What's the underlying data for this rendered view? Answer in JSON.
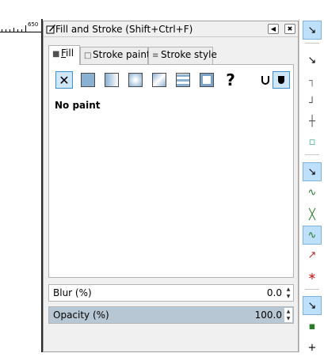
{
  "ruler": {
    "label": "650"
  },
  "dialog": {
    "title": "Fill and Stroke (Shift+Ctrl+F)",
    "tabs": [
      {
        "label": "Fill",
        "mnemonic": "F",
        "rest": "ill",
        "active": true
      },
      {
        "label": "Stroke paint"
      },
      {
        "label": "Stroke style"
      }
    ],
    "paint_modes": [
      "no-paint",
      "flat-color",
      "linear-gradient",
      "radial-gradient",
      "mesh-gradient",
      "pattern",
      "swatch",
      "unset"
    ],
    "selected_paint_mode": "no-paint",
    "fill_rule_buttons": [
      "fill-rule-evenodd",
      "fill-rule-nonzero"
    ],
    "paint_status": "No paint",
    "blur": {
      "label": "Blur (%)",
      "value": "0.0"
    },
    "opacity": {
      "label": "Opacity (%)",
      "value": "100.0"
    }
  },
  "toolbar_right": {
    "items": [
      "snap-enable",
      "snap-bbox",
      "snap-bbox-edge",
      "snap-bbox-corner",
      "snap-bbox-midpoint",
      "snap-bbox-center",
      "snap-nodes",
      "snap-paths",
      "snap-path-intersection",
      "snap-nodes-cusp",
      "snap-nodes-smooth",
      "snap-line-midpoint",
      "snap-others",
      "snap-object-center",
      "snap-rotation-center"
    ]
  },
  "colors": {
    "accent": "#3c8fd2",
    "selected_bg": "#cfe6fb",
    "slider_fill": "#b7c7d4"
  }
}
